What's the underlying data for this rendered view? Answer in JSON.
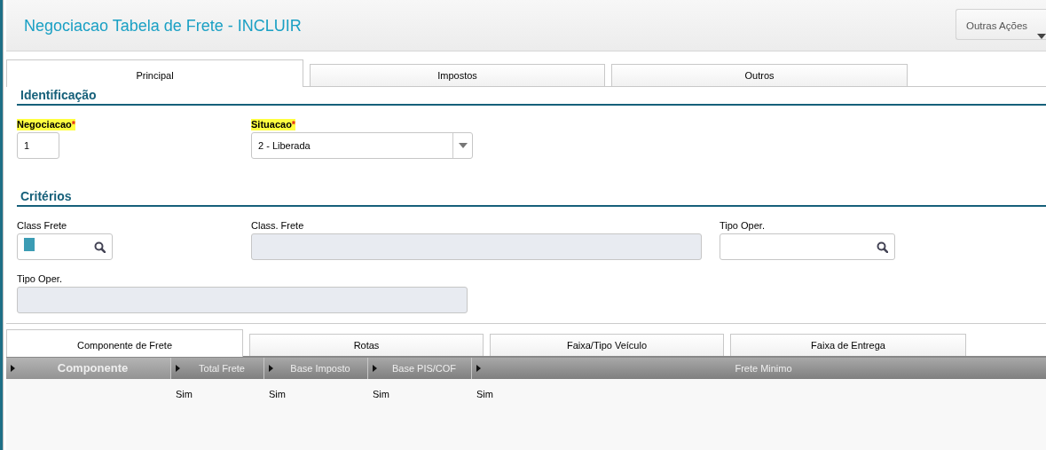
{
  "header": {
    "title": "Negociacao Tabela de Frete - INCLUIR",
    "actions_button": "Outras Ações"
  },
  "tabs": [
    {
      "label": "Principal",
      "selected": true
    },
    {
      "label": "Impostos",
      "selected": false
    },
    {
      "label": "Outros",
      "selected": false
    }
  ],
  "sections": [
    {
      "title": "Identificação",
      "fields": [
        {
          "kind": "text",
          "label": "Negociacao",
          "required": true,
          "required_mark": "*",
          "value": "1"
        },
        {
          "kind": "select",
          "label": "Situacao",
          "required": true,
          "required_mark": "*",
          "value": "2 - Liberada"
        }
      ]
    },
    {
      "title": "Critérios",
      "fields": [
        {
          "kind": "lookup",
          "label": "Class Frete",
          "required": false,
          "focused": true
        },
        {
          "kind": "readonly",
          "label": "Class. Frete",
          "required": false
        },
        {
          "kind": "lookup",
          "label": "Tipo Oper.",
          "required": false,
          "focused": false
        },
        {
          "kind": "readonly",
          "label": "Tipo Oper.",
          "required": false
        }
      ]
    }
  ],
  "detail_tabs": [
    {
      "label": "Componente de Frete",
      "selected": true
    },
    {
      "label": "Rotas",
      "selected": false
    },
    {
      "label": "Faixa/Tipo Veículo",
      "selected": false
    },
    {
      "label": "Faixa de Entrega",
      "selected": false
    }
  ],
  "grid": {
    "columns": [
      {
        "label": "Componente",
        "selected": true
      },
      {
        "label": "Total Frete",
        "selected": false
      },
      {
        "label": "Base Imposto",
        "selected": false
      },
      {
        "label": "Base PIS/COF",
        "selected": false
      },
      {
        "label": "Frete Minimo",
        "selected": false
      }
    ],
    "rows": [
      {
        "cells": [
          null,
          "Sim",
          "Sim",
          "Sim",
          "Sim"
        ]
      }
    ]
  }
}
